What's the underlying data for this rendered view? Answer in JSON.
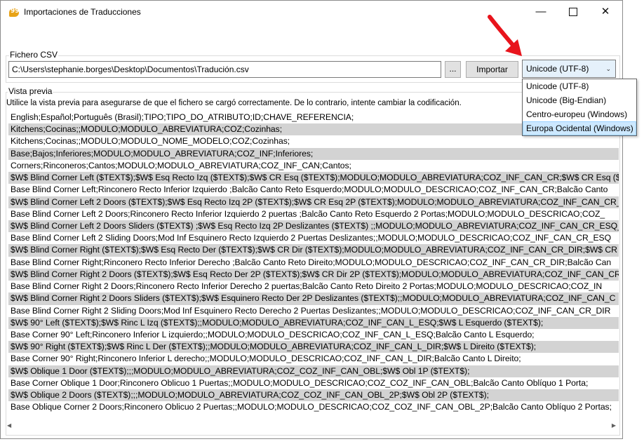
{
  "window": {
    "title": "Importaciones de Traducciones",
    "minimize_glyph": "—",
    "close_glyph": "✕"
  },
  "csv": {
    "group_label": "Fichero CSV",
    "path": "C:\\Users\\stephanie.borges\\Desktop\\Documentos\\Tradución.csv",
    "browse_label": "...",
    "import_label": "Importar",
    "encoding_selected": "Unicode (UTF-8)",
    "encoding_options": [
      "Unicode (UTF-8)",
      "Unicode (Big-Endian)",
      "Centro-europeu (Windows)",
      "Europa Ocidental (Windows)"
    ]
  },
  "preview": {
    "group_label": "Vista previa",
    "hint": "Utilice la vista previa para asegurarse de que el fichero se cargó correctamente. De lo contrario, intente cambiar la codificación.",
    "rows": [
      "English;Español;Português (Brasil);TIPO;TIPO_DO_ATRIBUTO;ID;CHAVE_REFERENCIA;",
      "Kitchens;Cocinas;;MODULO;MODULO_ABREVIATURA;COZ;Cozinhas;",
      "Kitchens;Cocinas;;MODULO;MODULO_NOME_MODELO;COZ;Cozinhas;",
      "Base;Bajos;Inferiores;MODULO;MODULO_ABREVIATURA;COZ_INF;Inferiores;",
      "Corners;Rinconeros;Cantos;MODULO;MODULO_ABREVIATURA;COZ_INF_CAN;Cantos;",
      "$W$ Blind Corner Left ($TEXT$);$W$ Esq Recto Izq ($TEXT$);$W$ CR Esq ($TEXT$);MODULO;MODULO_ABREVIATURA;COZ_INF_CAN_CR;$W$ CR Esq ($T",
      "Base Blind Corner Left;Rinconero Recto Inferior Izquierdo ;Balcão Canto Reto Esquerdo;MODULO;MODULO_DESCRICAO;COZ_INF_CAN_CR;Balcão Canto",
      "$W$ Blind Corner Left 2 Doors ($TEXT$);$W$ Esq Recto Izq 2P ($TEXT$);$W$ CR Esq 2P ($TEXT$);MODULO;MODULO_ABREVIATURA;COZ_INF_CAN_CR_E",
      "Base Blind Corner Left 2 Doors;Rinconero Recto Inferior Izquierdo 2 puertas ;Balcão Canto Reto Esquerdo 2 Portas;MODULO;MODULO_DESCRICAO;COZ_",
      "$W$ Blind Corner Left 2 Doors Sliders ($TEXT$) ;$W$ Esq Recto Izq 2P Deslizantes ($TEXT$) ;;MODULO;MODULO_ABREVIATURA;COZ_INF_CAN_CR_ESQ_",
      "Base Blind Corner Left 2 Sliding Doors;Mod Inf Esquinero Recto Izquierdo 2 Puertas Deslizantes;;MODULO;MODULO_DESCRICAO;COZ_INF_CAN_CR_ESQ",
      "$W$ Blind Corner Right ($TEXT$);$W$ Esq Recto Der ($TEXT$);$W$ CR Dir ($TEXT$);MODULO;MODULO_ABREVIATURA;COZ_INF_CAN_CR_DIR;$W$ CR D",
      "Base Blind Corner Right;Rinconero Recto Inferior Derecho ;Balcão Canto Reto Direito;MODULO;MODULO_DESCRICAO;COZ_INF_CAN_CR_DIR;Balcão Can",
      "$W$ Blind Corner Right 2 Doors ($TEXT$);$W$ Esq Recto Der 2P ($TEXT$);$W$ CR Dir 2P ($TEXT$);MODULO;MODULO_ABREVIATURA;COZ_INF_CAN_CR",
      "Base Blind Corner Right 2 Doors;Rinconero Recto Inferior Derecho 2 puertas;Balcão Canto Reto Direito 2 Portas;MODULO;MODULO_DESCRICAO;COZ_IN",
      "$W$ Blind Corner Right 2 Doors Sliders ($TEXT$);$W$ Esquinero Recto Der 2P Deslizantes ($TEXT$);;MODULO;MODULO_ABREVIATURA;COZ_INF_CAN_C",
      "Base Blind Corner Right 2 Sliding Doors;Mod Inf Esquinero Recto Derecho 2 Puertas Deslizantes;;MODULO;MODULO_DESCRICAO;COZ_INF_CAN_CR_DIR",
      "$W$ 90° Left ($TEXT$);$W$ Rinc L Izq ($TEXT$);;MODULO;MODULO_ABREVIATURA;COZ_INF_CAN_L_ESQ;$W$ L Esquerdo ($TEXT$);",
      "Base Corner 90° Left;Rinconero Inferior L izquierdo;;MODULO;MODULO_DESCRICAO;COZ_INF_CAN_L_ESQ;Balcão Canto L Esquerdo;",
      "$W$ 90° Right ($TEXT$);$W$ Rinc L Der ($TEXT$);;MODULO;MODULO_ABREVIATURA;COZ_INF_CAN_L_DIR;$W$ L Direito ($TEXT$);",
      "Base Corner 90° Right;Rinconero Inferior L derecho;;MODULO;MODULO_DESCRICAO;COZ_INF_CAN_L_DIR;Balcão Canto L Direito;",
      "$W$ Oblique 1 Door ($TEXT$);;;MODULO;MODULO_ABREVIATURA;COZ_COZ_INF_CAN_OBL;$W$ Obl 1P ($TEXT$);",
      "Base Corner Oblique 1 Door;Rinconero Oblicuo 1 Puertas;;MODULO;MODULO_DESCRICAO;COZ_COZ_INF_CAN_OBL;Balcão Canto Oblíquo 1 Porta;",
      "$W$ Oblique 2 Doors ($TEXT$);;;MODULO;MODULO_ABREVIATURA;COZ_COZ_INF_CAN_OBL_2P;$W$ Obl 2P ($TEXT$);",
      "Base Oblique Corner 2 Doors;Rinconero Oblicuo 2 Puertas;;MODULO;MODULO_DESCRICAO;COZ_COZ_INF_CAN_OBL_2P;Balcão Canto Oblíquo 2 Portas;"
    ]
  },
  "colors": {
    "alt_row": "#d3d3d3",
    "selected_option": "#cce8ff",
    "annotation_arrow": "#e8141c"
  }
}
